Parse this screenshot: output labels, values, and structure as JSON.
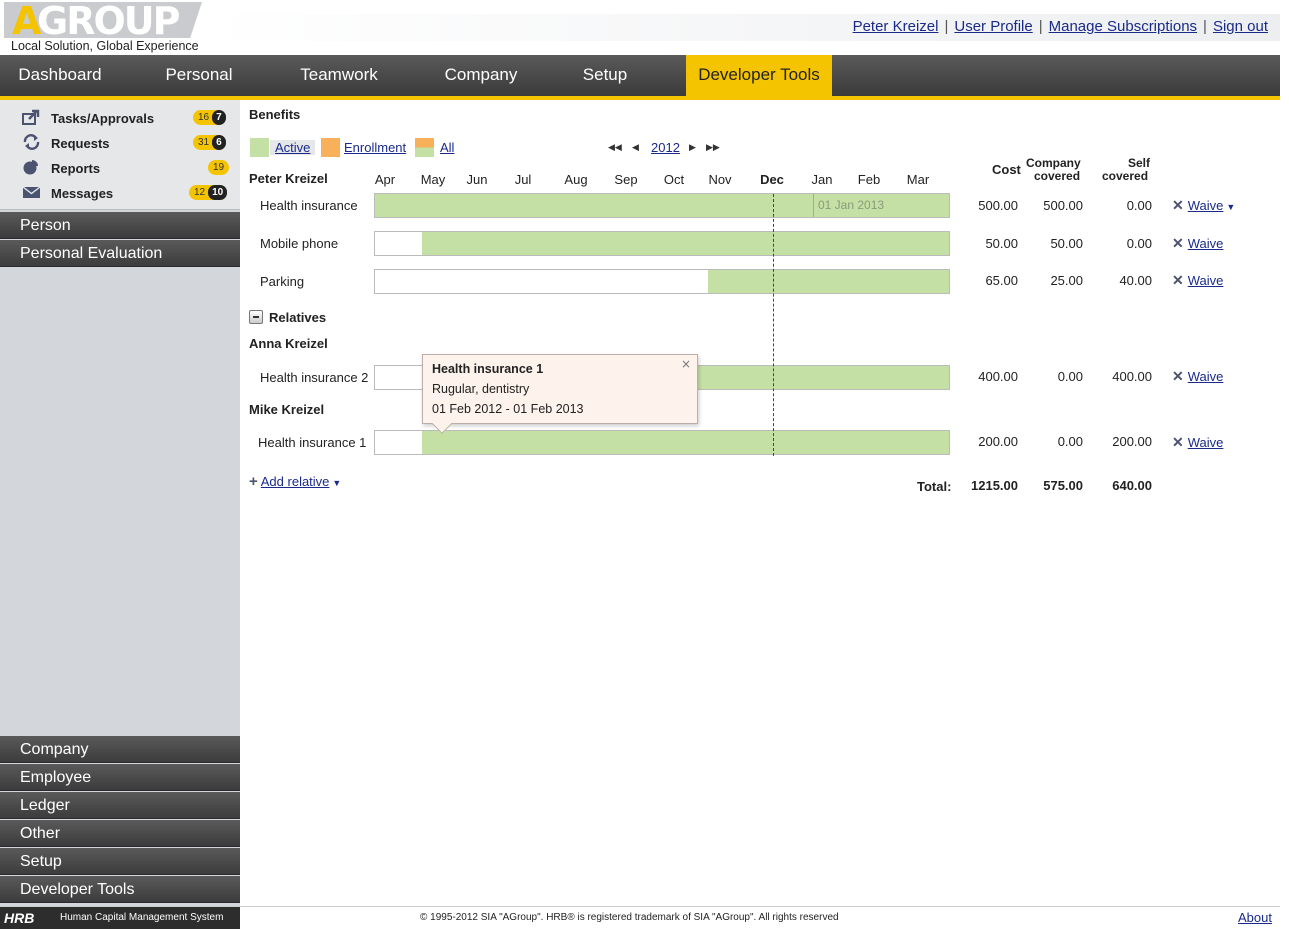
{
  "header": {
    "logo_a": "A",
    "logo_rest": "GROUP",
    "tagline": "Local Solution, Global Experience",
    "links": [
      "Peter Kreizel",
      "User Profile",
      "Manage Subscriptions",
      "Sign out"
    ],
    "separator": "|"
  },
  "mainnav": {
    "tabs": [
      "Dashboard",
      "Personal",
      "Teamwork",
      "Company",
      "Setup",
      "Developer Tools"
    ],
    "active": "Developer Tools"
  },
  "sidebar": {
    "quick": [
      {
        "label": "Tasks/Approvals",
        "count": "16",
        "dark": "7",
        "icon": "share-arrow-icon"
      },
      {
        "label": "Requests",
        "count": "31",
        "dark": "6",
        "icon": "refresh-icon"
      },
      {
        "label": "Reports",
        "count": "19",
        "dark": "",
        "icon": "pie-chart-icon"
      },
      {
        "label": "Messages",
        "count": "12",
        "dark": "10",
        "icon": "envelope-icon"
      }
    ],
    "groups_top": [
      "Person",
      "Personal Evaluation"
    ],
    "groups_bottom": [
      "Company",
      "Employee",
      "Ledger",
      "Other",
      "Setup",
      "Developer Tools"
    ]
  },
  "content": {
    "title": "Benefits",
    "legend": {
      "active": "Active",
      "enrollment": "Enrollment",
      "all": "All"
    },
    "year_nav": {
      "first": "◀◀",
      "prev": "◀",
      "year": "2012",
      "next": "▶",
      "last": "▶▶"
    },
    "columns": {
      "cost": "Cost",
      "company_covered_1": "Company",
      "company_covered_2": "covered",
      "self_covered_1": "Self",
      "self_covered_2": "covered"
    },
    "months": [
      "Apr",
      "May",
      "Jun",
      "Jul",
      "Aug",
      "Sep",
      "Oct",
      "Nov",
      "Dec",
      "Jan",
      "Feb",
      "Mar"
    ],
    "highlight_month": "Dec",
    "person": "Peter Kreizel",
    "rows": [
      {
        "label": "Health insurance",
        "cost": "500.00",
        "company": "500.00",
        "self": "0.00",
        "waive": "Waive",
        "marker": "01 Jan 2013",
        "start_fraction": 0.0
      },
      {
        "label": "Mobile phone",
        "cost": "50.00",
        "company": "50.00",
        "self": "0.00",
        "waive": "Waive",
        "start_fraction": 0.083
      },
      {
        "label": "Parking",
        "cost": "65.00",
        "company": "25.00",
        "self": "40.00",
        "waive": "Waive",
        "start_fraction": 0.58
      }
    ],
    "relatives_label": "Relatives",
    "relatives": [
      {
        "name": "Anna Kreizel",
        "label": "Health insurance 2",
        "cost": "400.00",
        "company": "0.00",
        "self": "400.00",
        "waive": "Waive",
        "start_fraction": 0.083
      },
      {
        "name": "Mike Kreizel",
        "label": "Health insurance 1",
        "cost": "200.00",
        "company": "0.00",
        "self": "200.00",
        "waive": "Waive",
        "start_fraction": 0.083
      }
    ],
    "add_relative": "Add relative",
    "total_label": "Total:",
    "totals": {
      "cost": "1215.00",
      "company": "575.00",
      "self": "640.00"
    },
    "tooltip": {
      "title": "Health insurance 1",
      "line1": "Rugular, dentistry",
      "line2": "01 Feb 2012 - 01 Feb 2013",
      "close": "×"
    }
  },
  "footer": {
    "hrb": "HRB",
    "system": "Human Capital Management System",
    "copyright": "© 1995-2012 SIA \"AGroup\". HRB® is registered trademark of SIA \"AGroup\". All rights reserved",
    "about": "About"
  },
  "colors": {
    "accent": "#f5c400",
    "active_fill": "#c5e0a5",
    "enrollment": "#f8b05a",
    "link": "#1a2a8a"
  }
}
